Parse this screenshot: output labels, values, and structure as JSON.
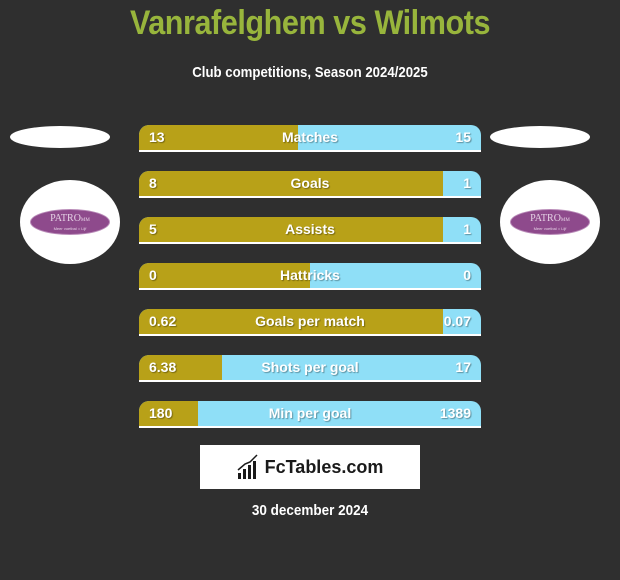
{
  "header": {
    "title": "Vanrafelghem vs Wilmots",
    "subtitle": "Club competitions, Season 2024/2025"
  },
  "teams": {
    "left": {
      "logo_text": "PATRO",
      "logo_suffix": "MM",
      "logo_tagline": "Meer voetbal = Lijf"
    },
    "right": {
      "logo_text": "PATRO",
      "logo_suffix": "MM",
      "logo_tagline": "Meer voetbal = Lijf"
    }
  },
  "colors": {
    "left": "#b8a118",
    "right": "#8fdff7",
    "title": "#98b53c",
    "background": "#2f2f2f"
  },
  "stats": [
    {
      "label": "Matches",
      "left": "13",
      "right": "15",
      "left_share": 0.4643
    },
    {
      "label": "Goals",
      "left": "8",
      "right": "1",
      "left_share": 0.8889
    },
    {
      "label": "Assists",
      "left": "5",
      "right": "1",
      "left_share": 0.8889
    },
    {
      "label": "Hattricks",
      "left": "0",
      "right": "0",
      "left_share": 0.5
    },
    {
      "label": "Goals per match",
      "left": "0.62",
      "right": "0.07",
      "left_share": 0.8889
    },
    {
      "label": "Shots per goal",
      "left": "6.38",
      "right": "17",
      "left_share": 0.2427
    },
    {
      "label": "Min per goal",
      "left": "180",
      "right": "1389",
      "left_share": 0.1718
    }
  ],
  "footer": {
    "brand": "FcTables.com",
    "brand_icon": "bar-chart-icon",
    "date": "30 december 2024"
  }
}
